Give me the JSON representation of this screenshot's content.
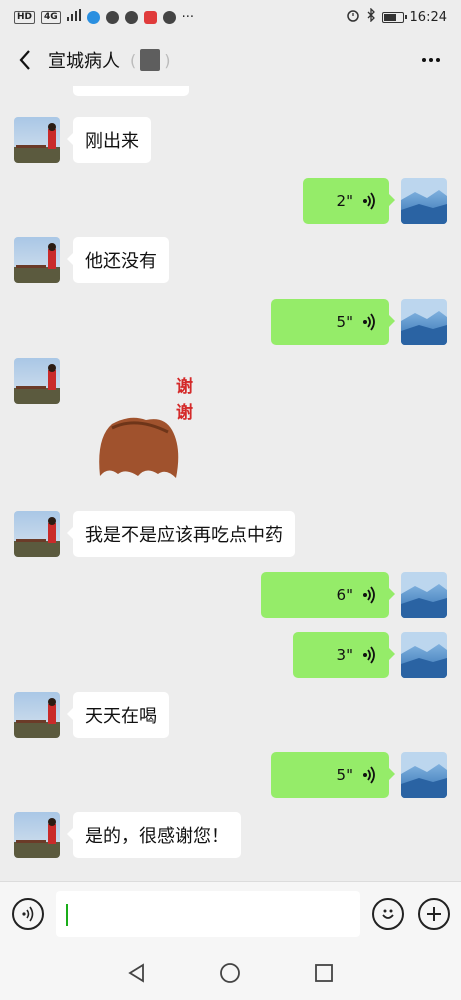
{
  "status_bar": {
    "left_badges": [
      "HD",
      "4G"
    ],
    "time": "16:24",
    "dots": "···"
  },
  "header": {
    "title": "宣城病人",
    "paren_open": "(",
    "paren_close": ")"
  },
  "messages": [
    {
      "side": "in",
      "text": "刚出来"
    },
    {
      "side": "out",
      "type": "voice",
      "duration": "2\""
    },
    {
      "side": "in",
      "text": "他还没有"
    },
    {
      "side": "out",
      "type": "voice",
      "duration": "5\""
    },
    {
      "side": "in",
      "type": "sticker",
      "sticker_text": "谢谢"
    },
    {
      "side": "in",
      "text": "我是不是应该再吃点中药"
    },
    {
      "side": "out",
      "type": "voice",
      "duration": "6\""
    },
    {
      "side": "out",
      "type": "voice",
      "duration": "3\""
    },
    {
      "side": "in",
      "text": "天天在喝"
    },
    {
      "side": "out",
      "type": "voice",
      "duration": "5\""
    },
    {
      "side": "in",
      "text": "是的，很感谢您！"
    }
  ],
  "input_bar": {
    "voice_icon": "voice-mode-icon",
    "emoji_icon": "emoji-icon",
    "plus_icon": "plus-icon",
    "value": ""
  },
  "nav_bar": {
    "icons": [
      "back-triangle-icon",
      "home-circle-icon",
      "recents-square-icon"
    ]
  },
  "colors": {
    "background": "#ededed",
    "outgoing_bubble": "#95ec69",
    "incoming_bubble": "#ffffff",
    "caret": "#1aad19"
  }
}
